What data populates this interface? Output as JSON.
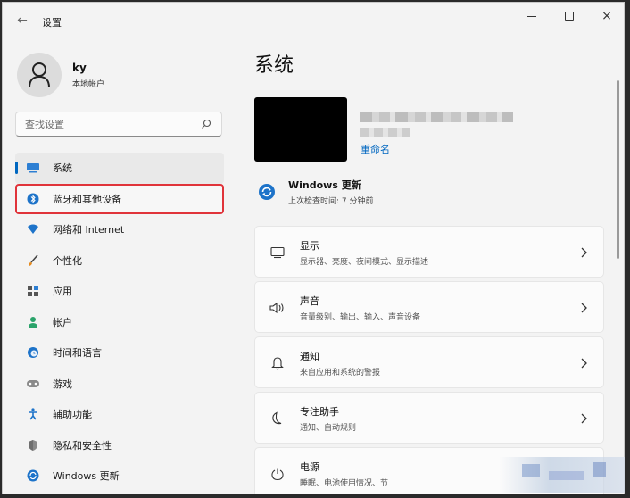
{
  "window": {
    "title": "设置",
    "controls": {
      "minimize": "minimize",
      "maximize": "maximize",
      "close": "×"
    },
    "back": "←"
  },
  "profile": {
    "name": "ky",
    "account_type": "本地帐户"
  },
  "search": {
    "placeholder": "查找设置"
  },
  "sidebar": {
    "items": [
      {
        "label": "系统",
        "icon": "system-icon",
        "selected": true
      },
      {
        "label": "蓝牙和其他设备",
        "icon": "bluetooth-icon",
        "highlighted": true
      },
      {
        "label": "网络和 Internet",
        "icon": "wifi-icon"
      },
      {
        "label": "个性化",
        "icon": "brush-icon"
      },
      {
        "label": "应用",
        "icon": "apps-icon"
      },
      {
        "label": "帐户",
        "icon": "account-icon"
      },
      {
        "label": "时间和语言",
        "icon": "clock-globe-icon"
      },
      {
        "label": "游戏",
        "icon": "gamepad-icon"
      },
      {
        "label": "辅助功能",
        "icon": "accessibility-icon"
      },
      {
        "label": "隐私和安全性",
        "icon": "shield-icon"
      },
      {
        "label": "Windows 更新",
        "icon": "windows-update-icon"
      }
    ]
  },
  "main": {
    "title": "系统",
    "device": {
      "rename": "重命名"
    },
    "update": {
      "title": "Windows 更新",
      "subtitle": "上次检查时间: 7 分钟前"
    },
    "rows": [
      {
        "title": "显示",
        "desc": "显示器、亮度、夜间模式、显示描述",
        "icon": "monitor-icon"
      },
      {
        "title": "声音",
        "desc": "音量级别、输出、输入、声音设备",
        "icon": "speaker-icon"
      },
      {
        "title": "通知",
        "desc": "来自应用和系统的警报",
        "icon": "bell-icon"
      },
      {
        "title": "专注助手",
        "desc": "通知、自动规则",
        "icon": "moon-icon"
      },
      {
        "title": "电源",
        "desc": "睡眠、电池使用情况、节",
        "icon": "power-icon"
      }
    ]
  },
  "colors": {
    "accent": "#0067c0",
    "highlight_border": "#e0333a",
    "background": "#f3f3f3"
  }
}
